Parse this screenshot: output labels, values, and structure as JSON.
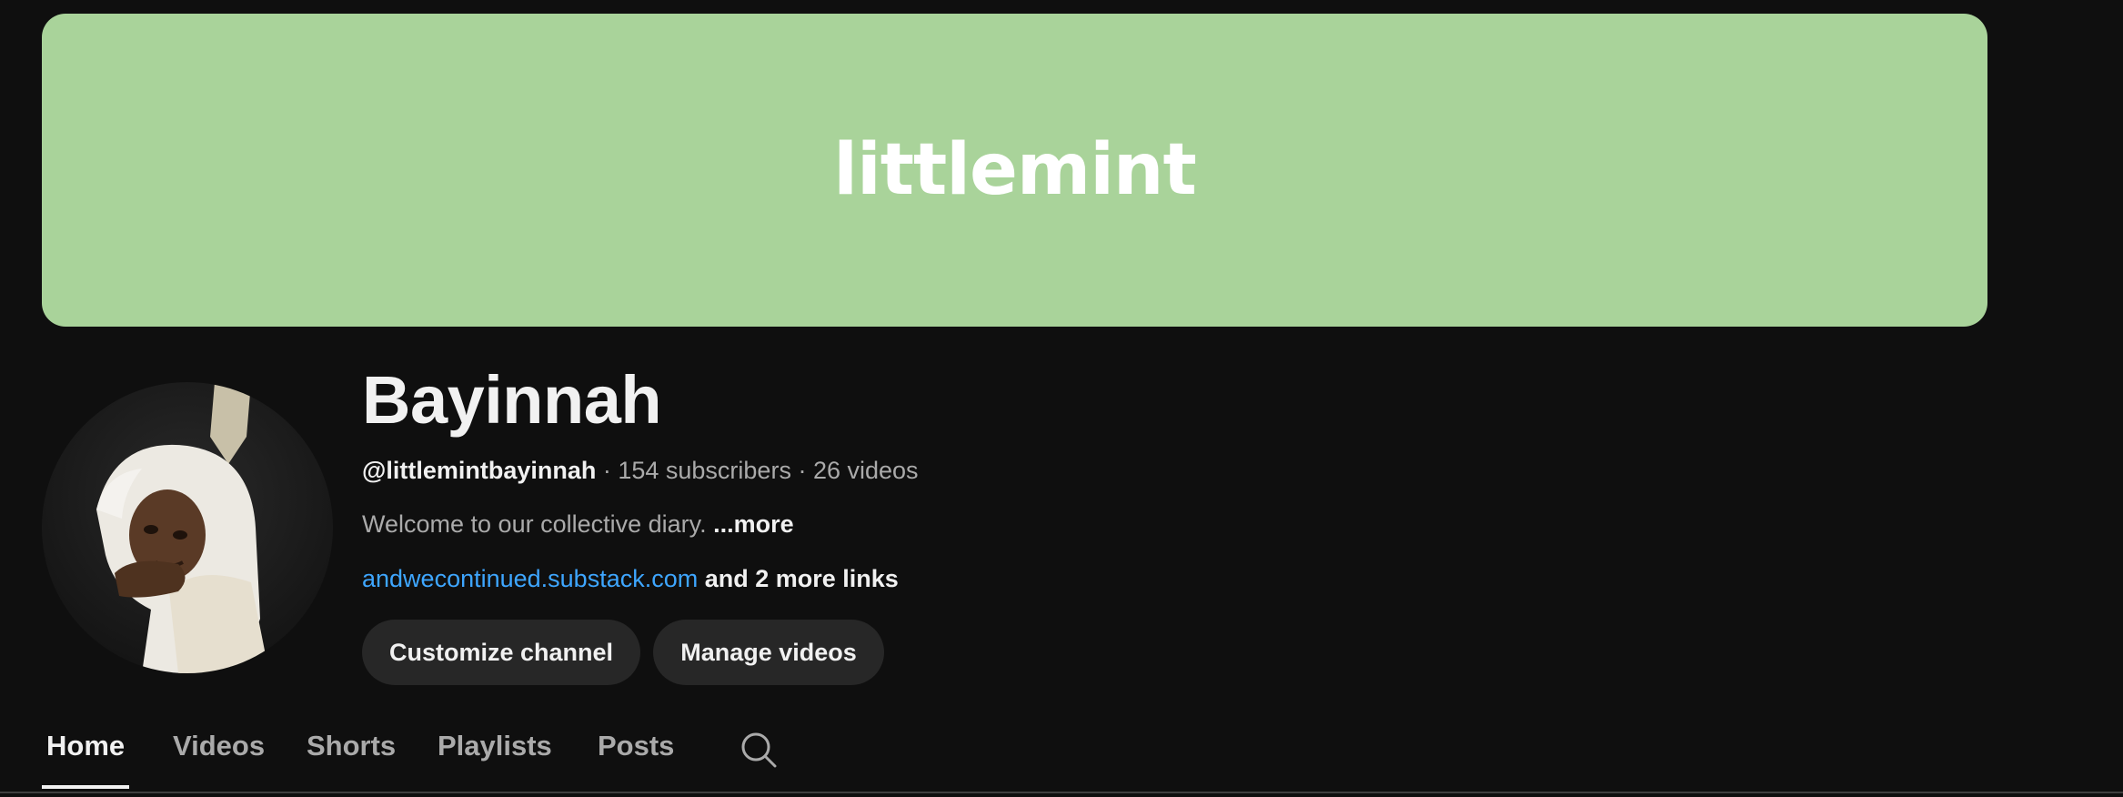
{
  "banner": {
    "text": "littlemint",
    "background_color": "#a9d39a"
  },
  "channel": {
    "name": "Bayinnah",
    "handle": "@littlemintbayinnah",
    "separator": " · ",
    "subscribers": "154 subscribers",
    "videos": "26 videos",
    "description": "Welcome to our collective diary.",
    "description_more": "...more",
    "link": "andwecontinued.substack.com",
    "more_links": "and 2 more links"
  },
  "buttons": {
    "customize": "Customize channel",
    "manage": "Manage videos"
  },
  "tabs": {
    "items": [
      {
        "label": "Home",
        "active": true
      },
      {
        "label": "Videos",
        "active": false
      },
      {
        "label": "Shorts",
        "active": false
      },
      {
        "label": "Playlists",
        "active": false
      },
      {
        "label": "Posts",
        "active": false
      }
    ],
    "search_icon": "search-icon"
  },
  "colors": {
    "page_background": "#0f0f0f",
    "link": "#3ea6ff",
    "button_background": "#272727"
  }
}
